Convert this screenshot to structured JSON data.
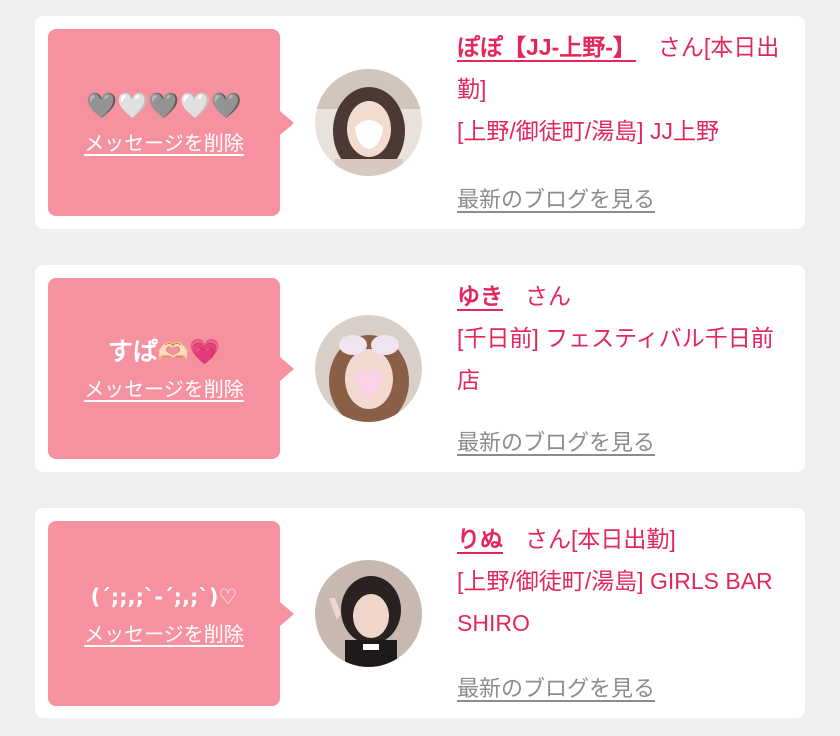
{
  "messages": [
    {
      "message": "🩶🤍🩶🤍🩶",
      "delete_label": "メッセージを削除",
      "name": "ぽぽ【JJ-上野-】",
      "honorific": "さん",
      "status": "[本日出勤]",
      "area_shop": "[上野/御徒町/湯島] JJ上野",
      "blog_label": "最新のブログを見る"
    },
    {
      "message": "すぱ🫶🏻💗",
      "delete_label": "メッセージを削除",
      "name": "ゆき",
      "honorific": "さん",
      "status": "",
      "area_shop": "[千日前] フェスティバル千日前店",
      "blog_label": "最新のブログを見る"
    },
    {
      "message": "(ˊ;;,;ˋ-ˊ;,;ˋ)♡",
      "delete_label": "メッセージを削除",
      "name": "りぬ",
      "honorific": "さん",
      "status": "[本日出勤]",
      "area_shop": "[上野/御徒町/湯島] GIRLS BAR SHIRO",
      "blog_label": "最新のブログを見る"
    }
  ],
  "colors": {
    "accent": "#e4265c",
    "bubble": "#f6919f",
    "background": "#efeff0",
    "link_gray": "#8c8c8c"
  },
  "icons": [
    "avatar-photo",
    "heart-icon"
  ]
}
